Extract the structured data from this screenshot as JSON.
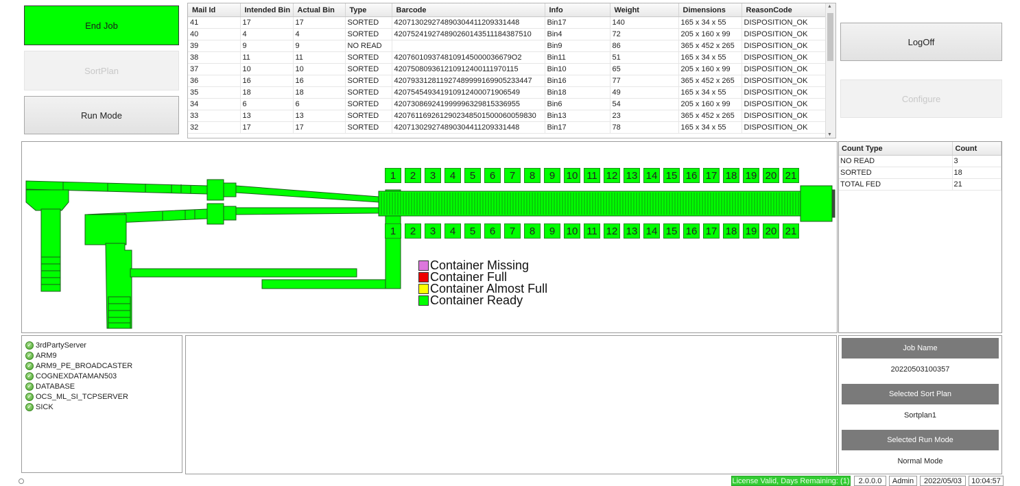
{
  "buttons": {
    "end_job": "End Job",
    "sort_plan": "SortPlan",
    "run_mode": "Run Mode",
    "log_off": "LogOff",
    "configure": "Configure"
  },
  "mail_table": {
    "columns": [
      "Mail Id",
      "Intended Bin",
      "Actual Bin",
      "Type",
      "Barcode",
      "Info",
      "Weight",
      "Dimensions",
      "ReasonCode"
    ],
    "rows": [
      [
        "41",
        "17",
        "17",
        "SORTED",
        "420713029274890304411209331448",
        "Bin17",
        "140",
        "165 x 34 x 55",
        "DISPOSITION_OK"
      ],
      [
        "40",
        "4",
        "4",
        "SORTED",
        "420752419274890260143511184387510",
        "Bin4",
        "72",
        "205 x 160 x 99",
        "DISPOSITION_OK"
      ],
      [
        "39",
        "9",
        "9",
        "NO READ",
        "",
        "Bin9",
        "86",
        "365 x 452 x 265",
        "DISPOSITION_OK"
      ],
      [
        "38",
        "11",
        "11",
        "SORTED",
        "4207601093748109145000036679O2",
        "Bin11",
        "51",
        "165 x 34 x 55",
        "DISPOSITION_OK"
      ],
      [
        "37",
        "10",
        "10",
        "SORTED",
        "420750809361210912400111970115",
        "Bin10",
        "65",
        "205 x 160 x 99",
        "DISPOSITION_OK"
      ],
      [
        "36",
        "16",
        "16",
        "SORTED",
        "420793312811927489999169905233447",
        "Bin16",
        "77",
        "365 x 452 x 265",
        "DISPOSITION_OK"
      ],
      [
        "35",
        "18",
        "18",
        "SORTED",
        "420754549341910912400071906549",
        "Bin18",
        "49",
        "165 x 34 x 55",
        "DISPOSITION_OK"
      ],
      [
        "34",
        "6",
        "6",
        "SORTED",
        "420730869241999996329815336955",
        "Bin6",
        "54",
        "205 x 160 x 99",
        "DISPOSITION_OK"
      ],
      [
        "33",
        "13",
        "13",
        "SORTED",
        "4207611692612902348501500060059830",
        "Bin13",
        "23",
        "365 x 452 x 265",
        "DISPOSITION_OK"
      ],
      [
        "32",
        "17",
        "17",
        "SORTED",
        "420713029274890304411209331448",
        "Bin17",
        "78",
        "165 x 34 x 55",
        "DISPOSITION_OK"
      ]
    ]
  },
  "bins_top": [
    "1",
    "2",
    "3",
    "4",
    "5",
    "6",
    "7",
    "8",
    "9",
    "10",
    "11",
    "12",
    "13",
    "14",
    "15",
    "16",
    "17",
    "18",
    "19",
    "20",
    "21"
  ],
  "bins_bottom": [
    "1",
    "2",
    "3",
    "4",
    "5",
    "6",
    "7",
    "8",
    "9",
    "10",
    "11",
    "12",
    "13",
    "14",
    "15",
    "16",
    "17",
    "18",
    "19",
    "20",
    "21"
  ],
  "legend": [
    {
      "label": "Container Missing",
      "color": "#dd77dd"
    },
    {
      "label": "Container Full",
      "color": "#ee0000"
    },
    {
      "label": "Container Almost Full",
      "color": "#ffff00"
    },
    {
      "label": "Container Ready",
      "color": "#00ff00"
    }
  ],
  "count_table": {
    "columns": [
      "Count Type",
      "Count"
    ],
    "rows": [
      [
        "NO READ",
        "3"
      ],
      [
        "SORTED",
        "18"
      ],
      [
        "TOTAL FED",
        "21"
      ]
    ]
  },
  "services": [
    "3rdPartyServer",
    "ARM9",
    "ARM9_PE_BROADCASTER",
    "COGNEXDATAMAN503",
    "DATABASE",
    "OCS_ML_SI_TCPSERVER",
    "SICK"
  ],
  "job_info": {
    "job_name_label": "Job Name",
    "job_name": "20220503100357",
    "sort_plan_label": "Selected Sort Plan",
    "sort_plan": "Sortplan1",
    "run_mode_label": "Selected Run Mode",
    "run_mode": "Normal Mode"
  },
  "status_bar": {
    "license": "License Valid, Days Remaining: (1)",
    "version": "2.0.0.0",
    "user": "Admin",
    "date": "2022/05/03",
    "time": "10:04:57"
  },
  "colors": {
    "machine_green": "#00ff00",
    "status_green": "#33cc33",
    "header_gray": "#7a7a7a"
  }
}
